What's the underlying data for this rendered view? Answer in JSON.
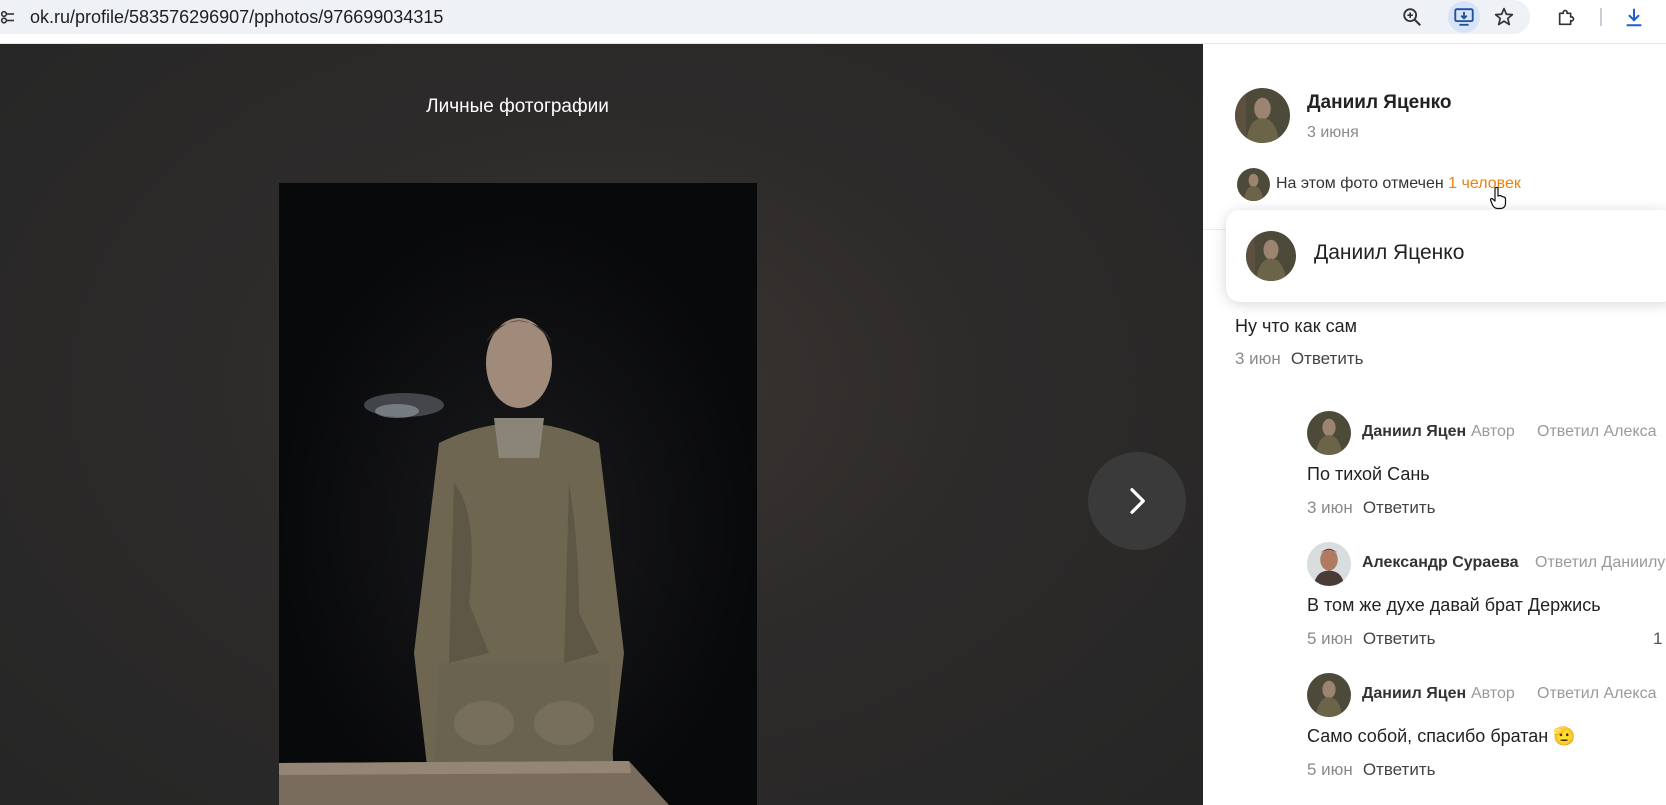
{
  "browser": {
    "url": "ok.ru/profile/583576296907/pphotos/976699034315",
    "icons": [
      "tune-icon",
      "zoom-icon",
      "install-app-icon",
      "bookmark-star-icon",
      "extensions-icon",
      "download-icon"
    ]
  },
  "viewer": {
    "album_title": "Личные фотографии",
    "next_icon": "chevron-right-icon"
  },
  "post": {
    "author": "Даниил Яценко",
    "date": "3 июня",
    "tag_prefix": "На этом фото отмечен",
    "tag_link": "1 человек"
  },
  "tag_popup": {
    "person": "Даниил Яценко"
  },
  "comments": [
    {
      "text": "Ну что как сам",
      "date": "3 июн",
      "reply": "Ответить"
    },
    {
      "author": "Даниил Яцен",
      "badge": "Автор",
      "replied": "Ответил Алекса",
      "text": "По тихой Сань",
      "date": "3 июн",
      "reply": "Ответить"
    },
    {
      "author": "Александр Сураева",
      "replied": "Ответил Даниилу",
      "text": "В том же духе давай брат Держись",
      "date": "5 июн",
      "reply": "Ответить",
      "likes": "1"
    },
    {
      "author": "Даниил Яцен",
      "badge": "Автор",
      "replied": "Ответил Алекса",
      "text": "Само собой, спасибо братан 🫡",
      "date": "5 июн",
      "reply": "Ответить"
    }
  ],
  "colors": {
    "link_orange": "#ee8208",
    "viewer_bg": "#2d2b2a",
    "panel_bg": "#ffffff"
  }
}
